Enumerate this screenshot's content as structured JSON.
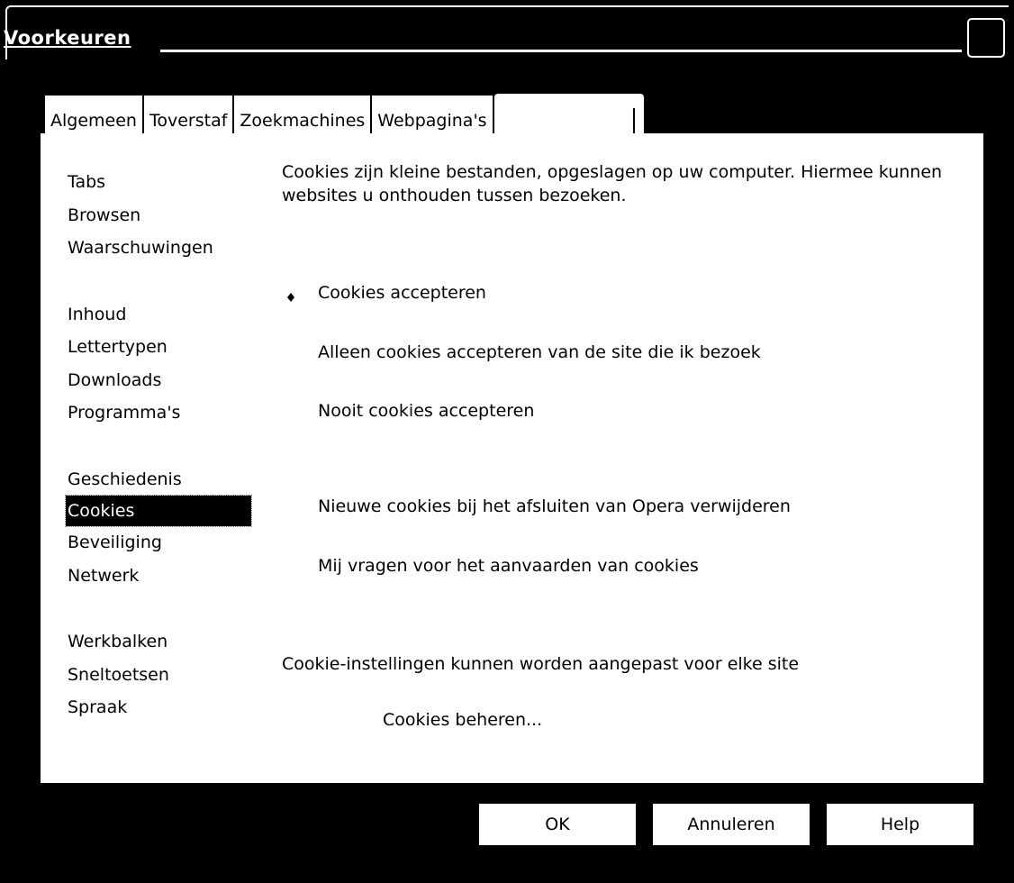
{
  "window": {
    "title": "Voorkeuren"
  },
  "tabs": [
    {
      "label": "Algemeen"
    },
    {
      "label": "Toverstaf"
    },
    {
      "label": "Zoekmachines"
    },
    {
      "label": "Webpagina's"
    },
    {
      "label": ""
    }
  ],
  "nav": {
    "groups": [
      [
        "Tabs",
        "Browsen",
        "Waarschuwingen"
      ],
      [
        "Inhoud",
        "Lettertypen",
        "Downloads",
        "Programma's"
      ],
      [
        "Geschiedenis",
        "Cookies",
        "Beveiliging",
        "Netwerk"
      ],
      [
        "Werkbalken",
        "Sneltoetsen",
        "Spraak"
      ]
    ],
    "selected": "Cookies"
  },
  "cookies": {
    "description": "Cookies zijn kleine bestanden, opgeslagen op uw computer. Hiermee kunnen websites u onthouden tussen bezoeken.",
    "options": {
      "accept_all": "Cookies accepteren",
      "accept_visited": "Alleen cookies accepteren van de site die ik bezoek",
      "never": "Nooit cookies accepteren"
    },
    "selected_option": "accept_all",
    "checkboxes": {
      "delete_on_exit": "Nieuwe cookies bij het afsluiten van Opera verwijderen",
      "ask": "Mij vragen voor het aanvaarden van cookies"
    },
    "per_site_label": "Cookie-instellingen kunnen worden aangepast voor elke site",
    "manage_button": "Cookies beheren..."
  },
  "buttons": {
    "ok": "OK",
    "cancel": "Annuleren",
    "help": "Help"
  },
  "colors": {
    "background": "#000000",
    "panel": "#ffffff",
    "selection": "#000000"
  }
}
